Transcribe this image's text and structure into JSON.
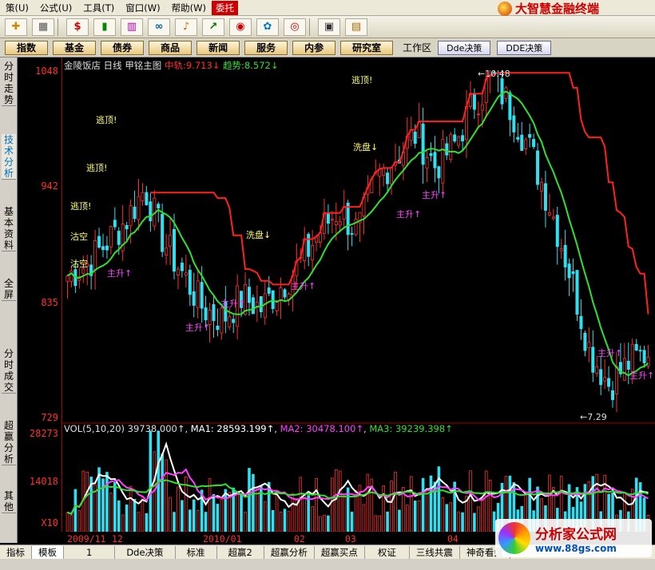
{
  "menu": [
    "策(U)",
    "公式(U)",
    "工具(T)",
    "窗口(W)",
    "帮助(W)",
    "委托"
  ],
  "brand": "大智慧金融终端",
  "toolbar_icons": [
    "plus-icon",
    "grid-icon",
    "dollar-icon",
    "bars-icon",
    "stripe-icon",
    "binoculars-icon",
    "bell-icon",
    "chart-icon",
    "disk-icon",
    "puzzle-icon",
    "target-icon",
    "window-icon",
    "books-icon"
  ],
  "nav": [
    "指数",
    "基金",
    "债券",
    "商品",
    "新闻",
    "服务",
    "内参",
    "研究室"
  ],
  "workspace": "工作区",
  "nav_right": [
    "Dde决策",
    "DDE决策"
  ],
  "sidebar_tabs": [
    "分时走势",
    "技术分析",
    "基本资料",
    "全屏",
    "分时成交",
    "超赢分析",
    "其他"
  ],
  "header": {
    "stock": "金陵饭店",
    "period": "日线",
    "indicator": "甲铭主图",
    "mid_label": "中轨:",
    "mid_value": "9.713↓",
    "trend_label": "趋势:",
    "trend_value": "8.572↓"
  },
  "y_labels": {
    "top": "1048",
    "upper": "942",
    "mid": "835",
    "low": "729"
  },
  "vol_labels": {
    "top": "28273",
    "mid": "14018",
    "unit": "X10"
  },
  "vol_header": {
    "name": "VOL(5,10,20)",
    "value": "39738.000↑",
    "ma1": "MA1: 28593.199↑",
    "ma2": "MA2: 30478.100↑",
    "ma3": "MA3: 39239.398↑"
  },
  "annotations": {
    "high_price": "←10.48",
    "low_price": "←7.29",
    "escape": "逃顶!",
    "empty": "沽空",
    "main_rise": "主升↑",
    "wash": "洗盘↓"
  },
  "x_labels": [
    "2009/11",
    "12",
    "2010/01",
    "02",
    "03",
    "04"
  ],
  "day_line": "日线",
  "bottom_tabs": [
    "指标",
    "模板",
    "1",
    "Dde决策",
    "标准",
    "超赢2",
    "超赢分析",
    "超赢买点",
    "权证",
    "三线共震",
    "神奇看盘"
  ],
  "watermark": {
    "title": "分析家公式网",
    "url": "www.88gs.com"
  },
  "colors": {
    "up": "#ff3030",
    "down": "#30e0f0",
    "band_upper": "#ff2020",
    "band_mid": "#30e030",
    "ma1": "#ffffff",
    "ma2": "#ff40ff",
    "ma3": "#30e030"
  },
  "chart_data": {
    "type": "candlestick",
    "title": "金陵饭店 日线",
    "ylim": [
      7.29,
      10.48
    ],
    "ohlc_sample_close": [
      8.6,
      8.7,
      8.9,
      9.1,
      9.4,
      8.9,
      8.6,
      8.3,
      8.2,
      8.4,
      8.3,
      8.5,
      8.7,
      9.0,
      9.2,
      9.0,
      9.5,
      9.7,
      9.9,
      9.6,
      9.8,
      10.2,
      10.4,
      10.1,
      9.7,
      9.2,
      8.6,
      7.9,
      7.6,
      7.8,
      7.9
    ],
    "high": 10.48,
    "low": 7.29,
    "vol_ylim": [
      0,
      28273
    ]
  }
}
